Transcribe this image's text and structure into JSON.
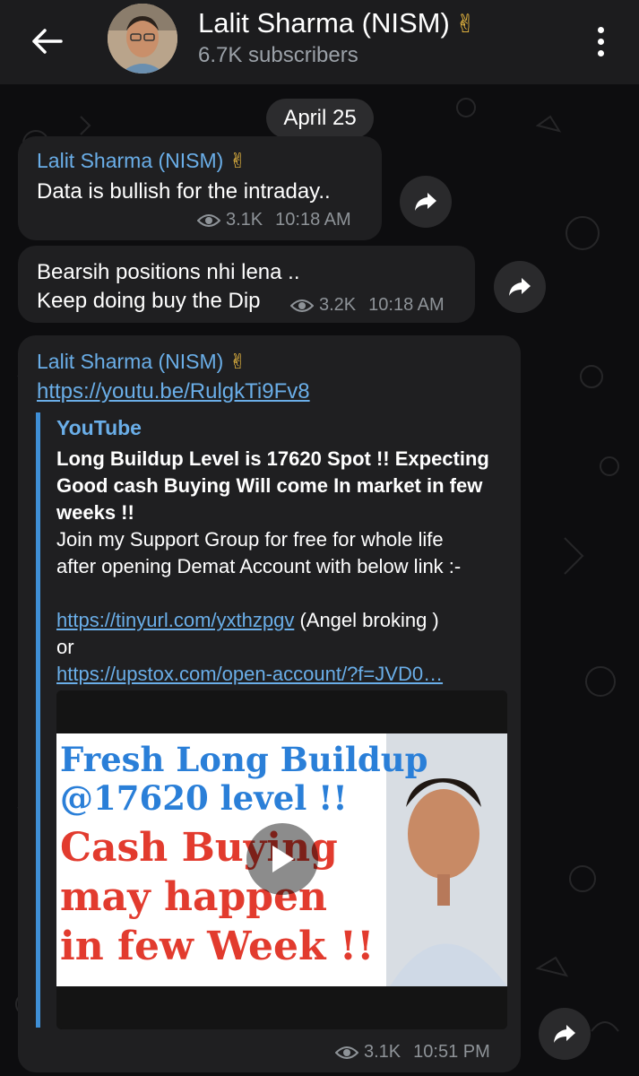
{
  "header": {
    "title": "Lalit Sharma (NISM)",
    "title_emoji": "✌",
    "subtitle": "6.7K subscribers"
  },
  "date_separator": "April 25",
  "messages": [
    {
      "sender": "Lalit Sharma (NISM)",
      "sender_emoji": "✌",
      "text": "Data is bullish for the intraday..",
      "views": "3.1K",
      "time": "10:18 AM"
    },
    {
      "line1": "Bearsih positions nhi lena ..",
      "line2": "Keep doing buy the Dip",
      "views": "3.2K",
      "time": "10:18 AM"
    },
    {
      "sender": "Lalit Sharma (NISM)",
      "sender_emoji": "✌",
      "link": "https://youtu.be/RulgkTi9Fv8",
      "preview": {
        "site": "YouTube",
        "title_line1": "Long Buildup Level is 17620 Spot !! Expecting",
        "title_line2": "Good cash Buying Will come In market in few",
        "title_line3": "weeks !!",
        "desc_line1": "Join my Support Group for free for whole life",
        "desc_line2": "after opening Demat Account with below link :-",
        "link1": "https://tinyurl.com/yxthzpgv",
        "link1_suffix": " (Angel broking )",
        "or": "or",
        "link2": "https://upstox.com/open-account/?f=JVD0…"
      },
      "thumbnail": {
        "line1": "Fresh Long Buildup",
        "line2": "@17620 level !!",
        "line3": "Cash Buying",
        "line4": "may happen",
        "line5": "in few Week !!"
      },
      "views": "3.1K",
      "time": "10:51 PM"
    }
  ],
  "colors": {
    "header_bg": "#1c1c1e",
    "bubble_bg": "#1f1f21",
    "link": "#6aaee8",
    "accent_bar": "#3f8fd6",
    "thumb_blue": "#2a7fd8",
    "thumb_red": "#e23b2e"
  },
  "icons": {
    "back": "arrow-left-icon",
    "menu": "more-vertical-icon",
    "views": "eye-icon",
    "share": "share-arrow-icon",
    "play": "play-icon"
  }
}
